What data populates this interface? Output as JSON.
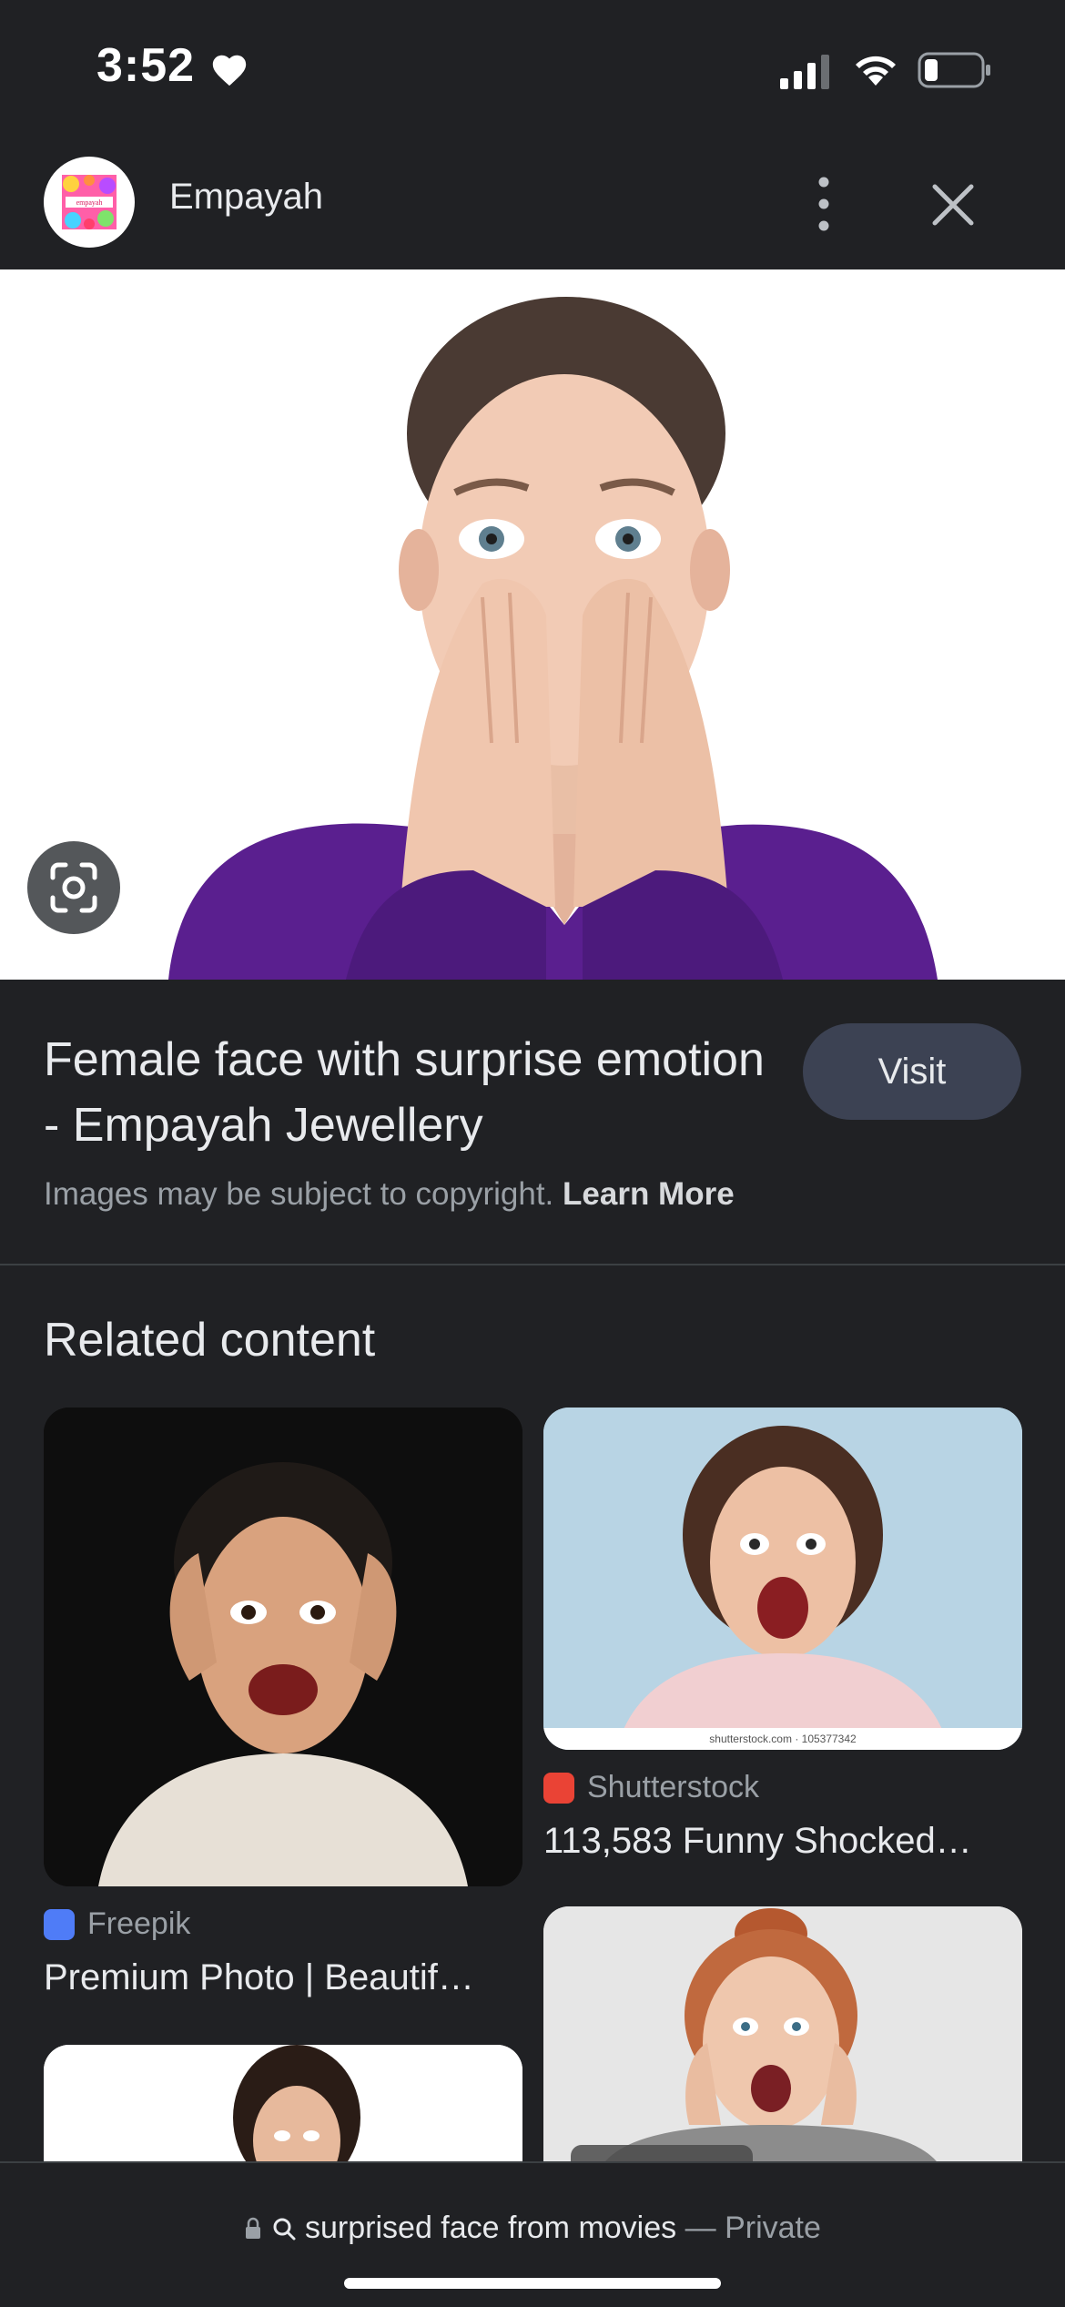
{
  "status_bar": {
    "time": "3:52",
    "icons": [
      "heart-icon",
      "signal-icon",
      "wifi-icon",
      "battery-icon"
    ]
  },
  "header": {
    "source_name": "Empayah",
    "avatar_text": "empayah",
    "more_icon": "more-vert-icon",
    "close_icon": "close-icon"
  },
  "hero": {
    "lens_icon": "google-lens-icon"
  },
  "result": {
    "title": "Female face with surprise emotion - Empayah Jewellery",
    "visit_label": "Visit",
    "copyright_text": "Images may be subject to copyright.",
    "learn_more": "Learn More"
  },
  "related": {
    "heading": "Related content",
    "items": [
      {
        "source": "Freepik",
        "title": "Premium Photo | Beautif…",
        "source_color": "#4f7cf7"
      },
      {
        "source": "Shutterstock",
        "title": "113,583 Funny Shocked…",
        "source_color": "#ea4335",
        "watermark": "shutterstock.com · 105377342"
      }
    ]
  },
  "bottom_bar": {
    "query": "surprised face from movies",
    "separator": "—",
    "mode": "Private"
  },
  "colors": {
    "background": "#202124",
    "visit_button": "#3c4253",
    "text_primary": "#e8eaed",
    "text_secondary": "#9aa0a6"
  }
}
